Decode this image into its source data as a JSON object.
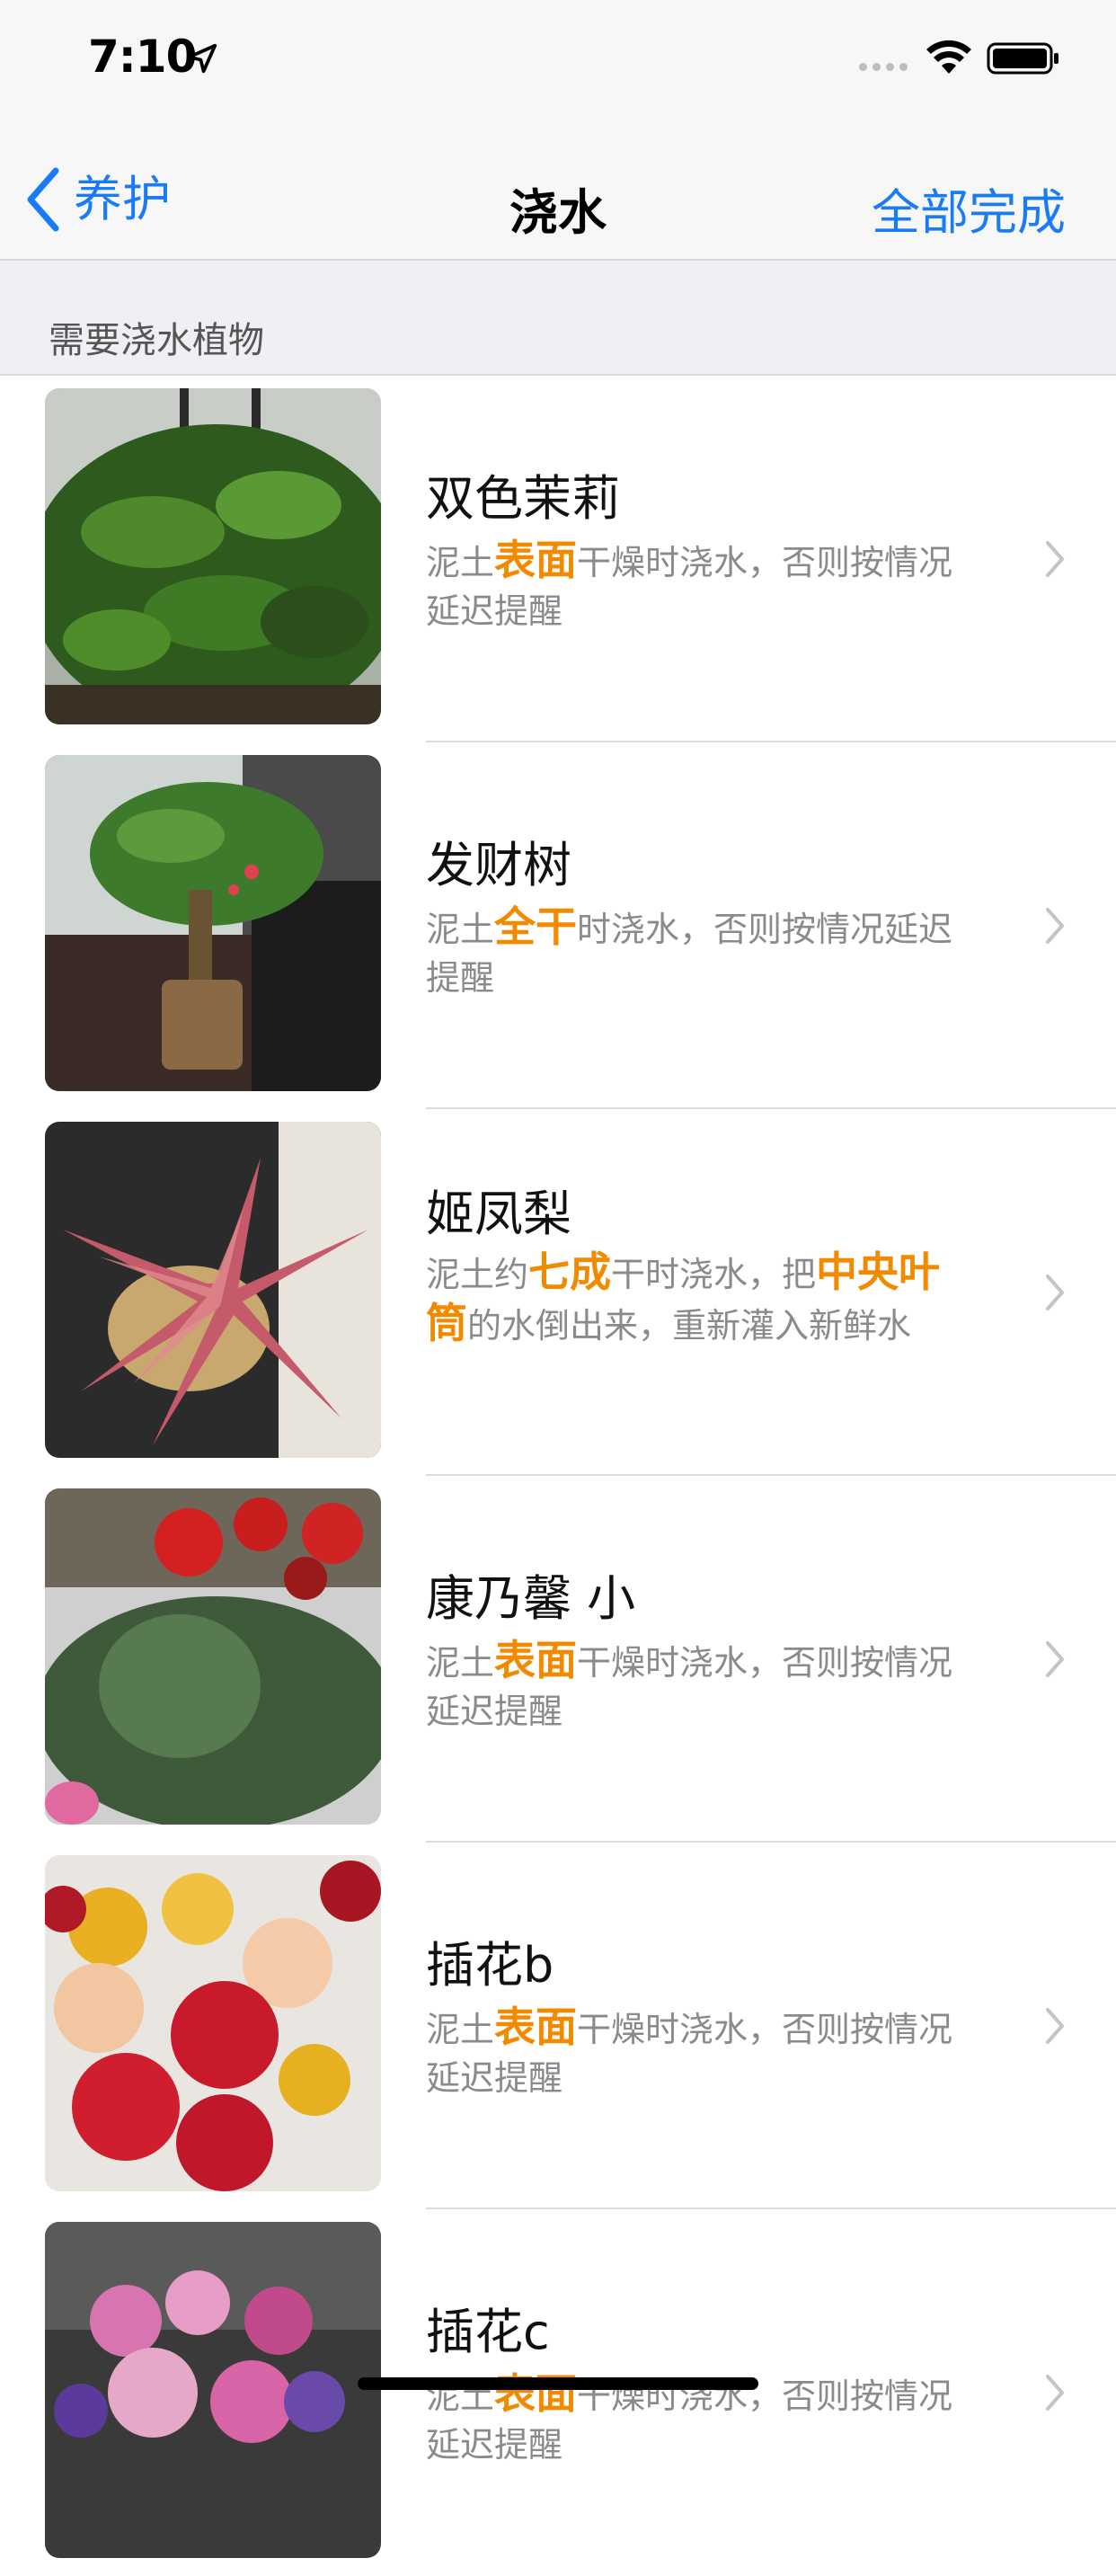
{
  "status_bar": {
    "time": "7:10"
  },
  "nav": {
    "back_label": "养护",
    "title": "浇水",
    "action_label": "全部完成"
  },
  "section": {
    "header": "需要浇水植物"
  },
  "plants": [
    {
      "name": "双色茉莉",
      "desc": [
        [
          "泥土",
          false
        ],
        [
          "表面",
          true
        ],
        [
          "干燥时浇水，否则按情况延迟提醒",
          false
        ]
      ]
    },
    {
      "name": "发财树",
      "desc": [
        [
          "泥土",
          false
        ],
        [
          "全干",
          true
        ],
        [
          "时浇水，否则按情况延迟提醒",
          false
        ]
      ]
    },
    {
      "name": "姬凤梨",
      "desc": [
        [
          "泥土约",
          false
        ],
        [
          "七成",
          true
        ],
        [
          "干时浇水，把",
          false
        ],
        [
          "中央叶筒",
          true
        ],
        [
          "的水倒出来，重新灌入新鲜水",
          false
        ]
      ]
    },
    {
      "name": "康乃馨 小",
      "desc": [
        [
          "泥土",
          false
        ],
        [
          "表面",
          true
        ],
        [
          "干燥时浇水，否则按情况延迟提醒",
          false
        ]
      ]
    },
    {
      "name": "插花b",
      "desc": [
        [
          "泥土",
          false
        ],
        [
          "表面",
          true
        ],
        [
          "干燥时浇水，否则按情况延迟提醒",
          false
        ]
      ]
    },
    {
      "name": "插花c",
      "desc": [
        [
          "泥土",
          false
        ],
        [
          "表面",
          true
        ],
        [
          "干燥时浇水，否则按情况延迟提醒",
          false
        ]
      ]
    }
  ],
  "colors": {
    "accent": "#1a7cf5",
    "highlight": "#f28a00",
    "secondary_text": "#8a8a8a"
  },
  "icons": [
    "location-arrow-icon",
    "cellular-signal-icon",
    "wifi-icon",
    "battery-icon",
    "back-chevron-icon",
    "chevron-right-icon"
  ]
}
